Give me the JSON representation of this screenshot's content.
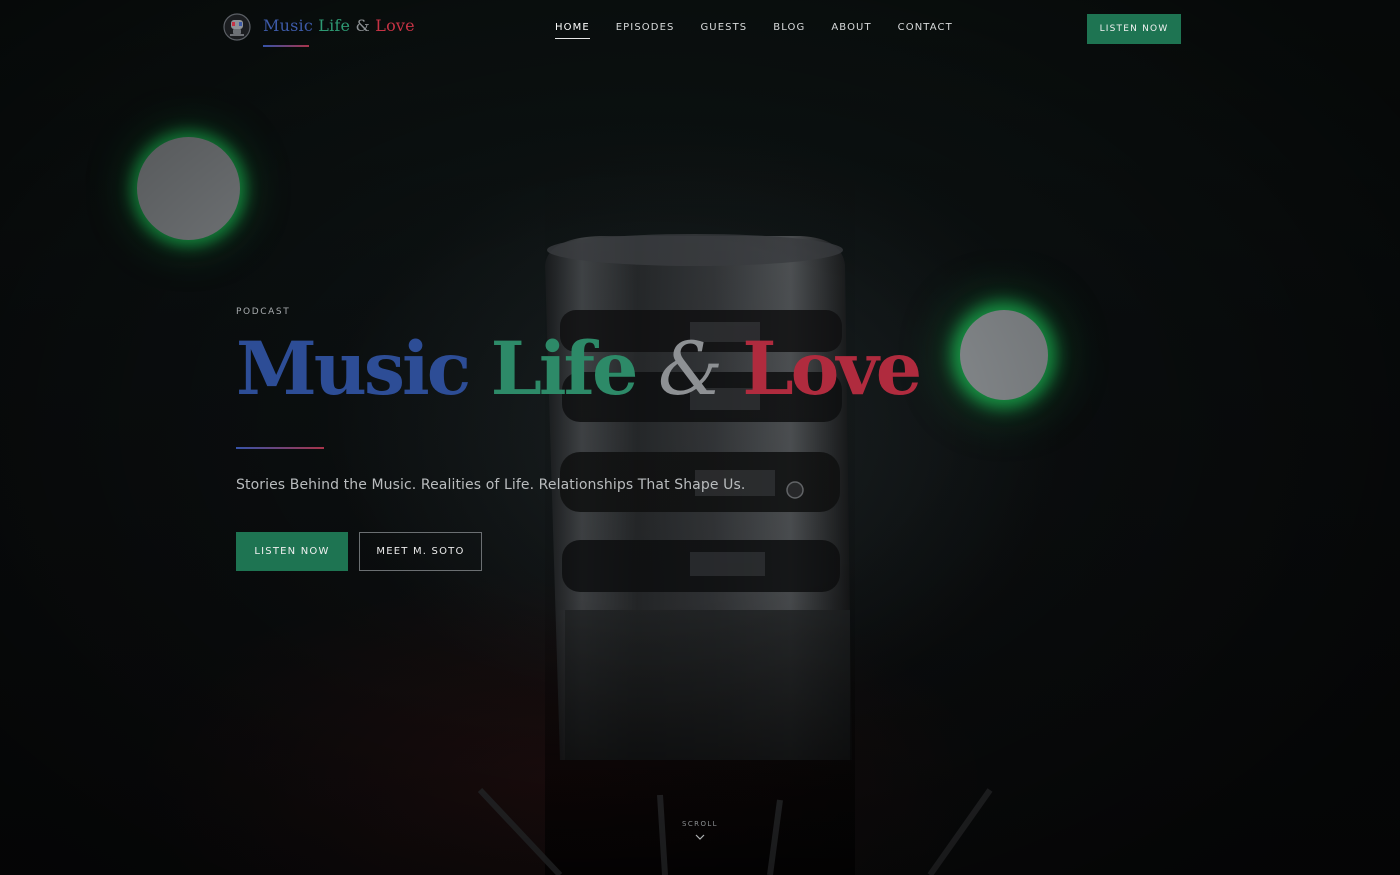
{
  "brand": {
    "words": [
      "Music",
      "Life",
      "&",
      "Love"
    ]
  },
  "nav": {
    "items": [
      {
        "label": "HOME",
        "active": true
      },
      {
        "label": "EPISODES",
        "active": false
      },
      {
        "label": "GUESTS",
        "active": false
      },
      {
        "label": "BLOG",
        "active": false
      },
      {
        "label": "ABOUT",
        "active": false
      },
      {
        "label": "CONTACT",
        "active": false
      }
    ],
    "cta_label": "LISTEN NOW"
  },
  "hero": {
    "eyebrow": "PODCAST",
    "title_words": [
      "Music",
      "Life",
      "&",
      "Love"
    ],
    "tagline": "Stories Behind the Music. Realities of Life. Relationships That Shape Us.",
    "primary_button": "LISTEN NOW",
    "secondary_button": "MEET M. SOTO",
    "scroll_label": "SCROLL"
  },
  "colors": {
    "music_blue": "#2d4d96",
    "life_green": "#2d8a68",
    "love_red": "#b02b3e",
    "button_green": "#1e7452",
    "background": "#0b0e0f"
  },
  "icons": {
    "logo": "microphone-emblem-icon",
    "scroll": "chevron-down-icon"
  }
}
